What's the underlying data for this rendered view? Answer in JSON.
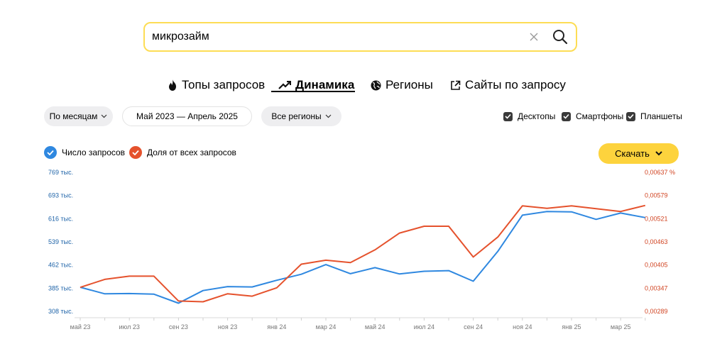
{
  "search": {
    "value": "микрозайм"
  },
  "tabs": [
    {
      "label": "Топы запросов",
      "icon": "flame-icon"
    },
    {
      "label": "Динамика",
      "icon": "trend-icon",
      "active": true
    },
    {
      "label": "Регионы",
      "icon": "globe-icon"
    },
    {
      "label": "Сайты по запросу",
      "icon": "external-link-icon"
    }
  ],
  "filters": {
    "period_type": "По месяцам",
    "date_range": "Май 2023 — Апрель 2025",
    "regions": "Все регионы"
  },
  "devices": [
    {
      "label": "Десктопы",
      "checked": true
    },
    {
      "label": "Смартфоны",
      "checked": true
    },
    {
      "label": "Планшеты",
      "checked": true
    }
  ],
  "legend": {
    "count_label": "Число запросов",
    "share_label": "Доля от всех запросов"
  },
  "download": {
    "label": "Скачать"
  },
  "colors": {
    "accent": "#fddd55",
    "count_series": "#2f88e0",
    "share_series": "#e5522d",
    "count_axis": "#1e63a8",
    "share_axis": "#d14422"
  },
  "chart_data": {
    "type": "line",
    "x": [
      "май 23",
      "июн 23",
      "июл 23",
      "авг 23",
      "сен 23",
      "окт 23",
      "ноя 23",
      "дек 23",
      "янв 24",
      "фев 24",
      "мар 24",
      "апр 24",
      "май 24",
      "июн 24",
      "июл 24",
      "авг 24",
      "сен 24",
      "окт 24",
      "ноя 24",
      "дек 24",
      "янв 25",
      "фев 25",
      "мар 25",
      "апр 25"
    ],
    "x_tick_labels": [
      "май 23",
      "июл 23",
      "сен 23",
      "ноя 23",
      "янв 24",
      "мар 24",
      "май 24",
      "июл 24",
      "сен 24",
      "ноя 24",
      "янв 25",
      "мар 25"
    ],
    "y_left": {
      "label": "Число запросов",
      "ticks": [
        "769 тыс.",
        "693 тыс.",
        "616 тыс.",
        "539 тыс.",
        "462 тыс.",
        "385 тыс.",
        "308 тыс."
      ],
      "range": [
        308,
        769
      ],
      "unit": "тыс."
    },
    "y_right": {
      "label": "Доля от всех запросов",
      "ticks": [
        "0,00637 %",
        "0,00579",
        "0,00521",
        "0,00463",
        "0,00405",
        "0,00347",
        "0,00289"
      ],
      "range": [
        0.00289,
        0.00637
      ],
      "unit": "%"
    },
    "series": [
      {
        "name": "Число запросов",
        "axis": "left",
        "values": [
          388,
          366,
          367,
          365,
          335,
          377,
          390,
          389,
          411,
          431,
          463,
          433,
          453,
          432,
          441,
          443,
          408,
          507,
          627,
          639,
          638,
          613,
          634,
          619
        ]
      },
      {
        "name": "Доля от всех запросов",
        "axis": "right",
        "values": [
          0.00349,
          0.00369,
          0.00377,
          0.00377,
          0.00315,
          0.00313,
          0.00333,
          0.00327,
          0.00348,
          0.00407,
          0.00417,
          0.00411,
          0.00443,
          0.00485,
          0.00502,
          0.00502,
          0.00425,
          0.00475,
          0.00553,
          0.00547,
          0.00553,
          0.00546,
          0.00539,
          0.00554
        ]
      }
    ],
    "grid": false,
    "legend_position": "top-left"
  }
}
